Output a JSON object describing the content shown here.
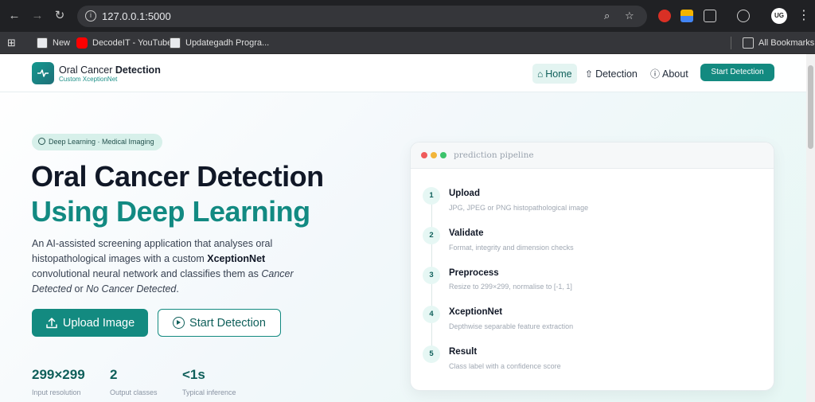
{
  "browser": {
    "url": "127.0.0.1:5000",
    "bookmarks": [
      {
        "label": "New",
        "icon": "uf-favicon"
      },
      {
        "label": "DecodeIT - YouTube",
        "icon": "youtube-favicon"
      },
      {
        "label": "Updategadh Progra...",
        "icon": "uf-favicon"
      }
    ],
    "all_bookmarks": "All Bookmarks",
    "profile": "UG"
  },
  "header": {
    "brand_title_plain": "Oral Cancer",
    "brand_title_bold": "Detection",
    "brand_subtitle": "Custom XceptionNet",
    "nav": [
      {
        "label": "Home",
        "icon": "home-icon",
        "active": true
      },
      {
        "label": "Detection",
        "icon": "upload-icon",
        "active": false
      },
      {
        "label": "About",
        "icon": "info-icon",
        "active": false
      }
    ],
    "cta": "Start Detection"
  },
  "hero": {
    "tag": "Deep Learning · Medical Imaging",
    "title_line1": "Oral Cancer Detection",
    "title_line2": "Using Deep Learning",
    "desc_1": "An AI-assisted screening application that analyses oral histopathological images with a custom ",
    "desc_model": "XceptionNet",
    "desc_2": " convolutional neural network and classifies them as ",
    "desc_class1": "Cancer Detected",
    "desc_3": " or ",
    "desc_class2": "No Cancer Detected",
    "desc_4": ".",
    "upload_button": "Upload Image",
    "start_button": "Start Detection"
  },
  "stats": [
    {
      "value": "299×299",
      "label": "Input resolution"
    },
    {
      "value": "2",
      "label": "Output classes"
    },
    {
      "value": "<1s",
      "label": "Typical inference"
    }
  ],
  "pipeline": {
    "title": "prediction pipeline",
    "steps": [
      {
        "num": "1",
        "title": "Upload",
        "desc": "JPG, JPEG or PNG histopathological image"
      },
      {
        "num": "2",
        "title": "Validate",
        "desc": "Format, integrity and dimension checks"
      },
      {
        "num": "3",
        "title": "Preprocess",
        "desc": "Resize to 299×299, normalise to [-1, 1]"
      },
      {
        "num": "4",
        "title": "XceptionNet",
        "desc": "Depthwise separable feature extraction"
      },
      {
        "num": "5",
        "title": "Result",
        "desc": "Class label with a confidence score"
      }
    ]
  },
  "colors": {
    "accent": "#138a80",
    "accent_dark": "#0f5f5a",
    "heading": "#111827"
  }
}
